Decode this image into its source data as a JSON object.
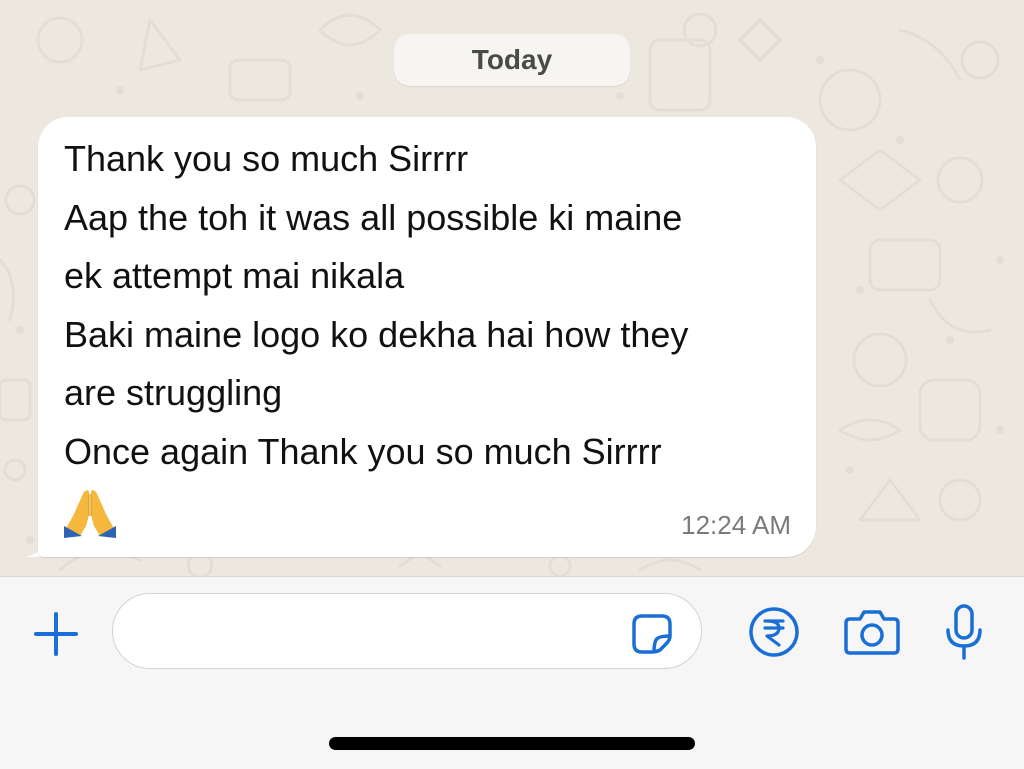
{
  "chat": {
    "date_separator": "Today",
    "message": {
      "lines": [
        "Thank you so much Sirrrr",
        "Aap the toh it was all possible ki maine",
        "ek attempt mai nikala",
        "Baki maine logo ko dekha hai how they",
        "are struggling",
        "Once again Thank you so much Sirrrr"
      ],
      "emoji": "folded-hands-emoji",
      "time": "12:24 AM"
    }
  },
  "composer": {
    "input_value": "",
    "icons": [
      "plus-icon",
      "sticker-icon",
      "rupee-payment-icon",
      "camera-icon",
      "microphone-icon"
    ]
  },
  "colors": {
    "accent": "#1a6fd6",
    "chat_background": "#ece8e0",
    "bubble": "#ffffff",
    "composer_background": "#f6f6f6"
  }
}
